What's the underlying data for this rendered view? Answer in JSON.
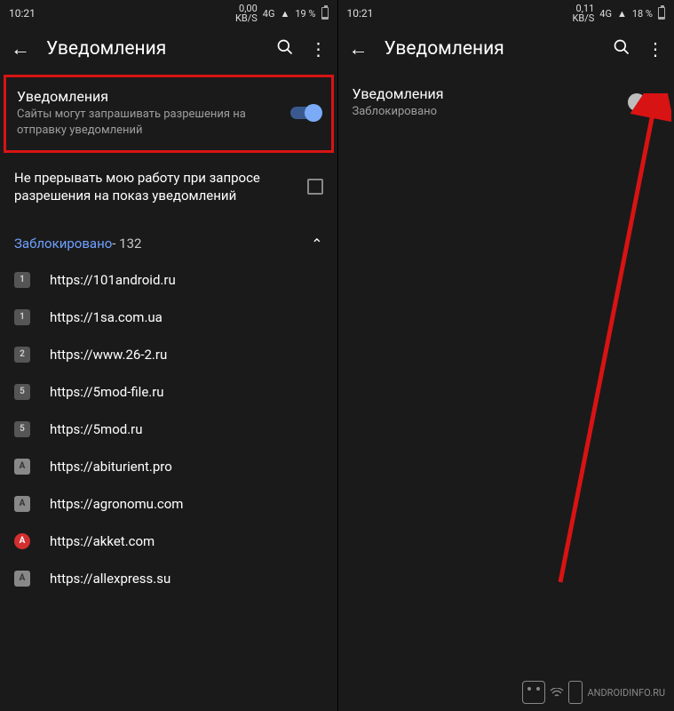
{
  "left": {
    "status": {
      "time": "10:21",
      "speed_top": "0,00",
      "speed_bot": "KB/S",
      "net": "4G",
      "battery": "19 %"
    },
    "appbar": {
      "title": "Уведомления"
    },
    "toggle": {
      "heading": "Уведомления",
      "sub": "Сайты могут запрашивать разрешения на отправку уведомлений",
      "on": true
    },
    "checkrow": {
      "text": "Не прерывать мою работу при запросе разрешения на показ уведомлений"
    },
    "group": {
      "label": "Заблокировано",
      "count": " - 132"
    },
    "sites": [
      {
        "icon": "1",
        "cls": "gray",
        "url": "https://101android.ru"
      },
      {
        "icon": "1",
        "cls": "gray",
        "url": "https://1sa.com.ua"
      },
      {
        "icon": "2",
        "cls": "gray",
        "url": "https://www.26-2.ru"
      },
      {
        "icon": "5",
        "cls": "gray",
        "url": "https://5mod-file.ru"
      },
      {
        "icon": "5",
        "cls": "gray",
        "url": "https://5mod.ru"
      },
      {
        "icon": "A",
        "cls": "ltgray",
        "url": "https://abiturient.pro"
      },
      {
        "icon": "A",
        "cls": "ltgray",
        "url": "https://agronomu.com"
      },
      {
        "icon": "A",
        "cls": "red",
        "url": "https://akket.com"
      },
      {
        "icon": "A",
        "cls": "ltgray",
        "url": "https://allexpress.su"
      }
    ]
  },
  "right": {
    "status": {
      "time": "10:21",
      "speed_top": "0,11",
      "speed_bot": "KB/S",
      "net": "4G",
      "battery": "18 %"
    },
    "appbar": {
      "title": "Уведомления"
    },
    "toggle": {
      "heading": "Уведомления",
      "sub": "Заблокировано",
      "on": false
    }
  },
  "watermark": "ANDROIDINFO.RU"
}
